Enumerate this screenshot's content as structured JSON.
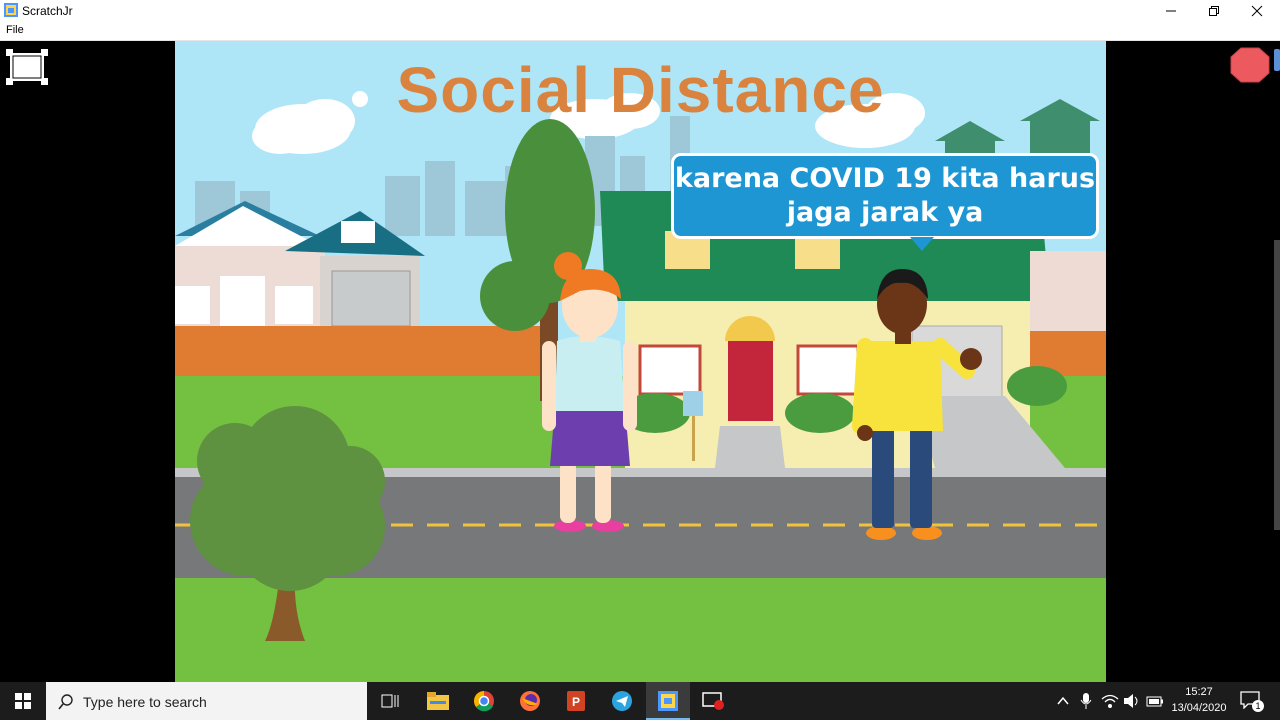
{
  "window": {
    "title": "ScratchJr",
    "icon": "scratchjr-app-icon",
    "controls": [
      "minimize-icon",
      "restore-icon",
      "close-icon"
    ]
  },
  "menu": {
    "file": "File"
  },
  "stage": {
    "title": "Social Distance",
    "speech": "karena COVID 19 kita harus jaga jarak ya",
    "scene": "suburban street with houses, trees, girl and boy characters"
  },
  "player_controls": {
    "fullscreen_icon": "exit-fullscreen-icon",
    "stop_icon": "stop-sign-icon",
    "stop_color": "#ec5a5f"
  },
  "taskbar": {
    "search_placeholder": "Type here to search",
    "time": "15:27",
    "date": "13/04/2020",
    "notification_count": "1",
    "apps": [
      "task-view-icon",
      "file-explorer-icon",
      "chrome-icon",
      "firefox-icon",
      "powerpoint-icon",
      "telegram-icon",
      "scratchjr-icon",
      "screen-recorder-icon"
    ],
    "tray": [
      "chevron-up-icon",
      "microphone-icon",
      "wifi-icon",
      "volume-icon",
      "battery-icon",
      "notification-icon"
    ]
  },
  "colors": {
    "title_orange": "#d9833f",
    "bubble_blue": "#1d96d3",
    "sky": "#aee6f8",
    "grass": "#74c041",
    "road": "#77787a"
  }
}
